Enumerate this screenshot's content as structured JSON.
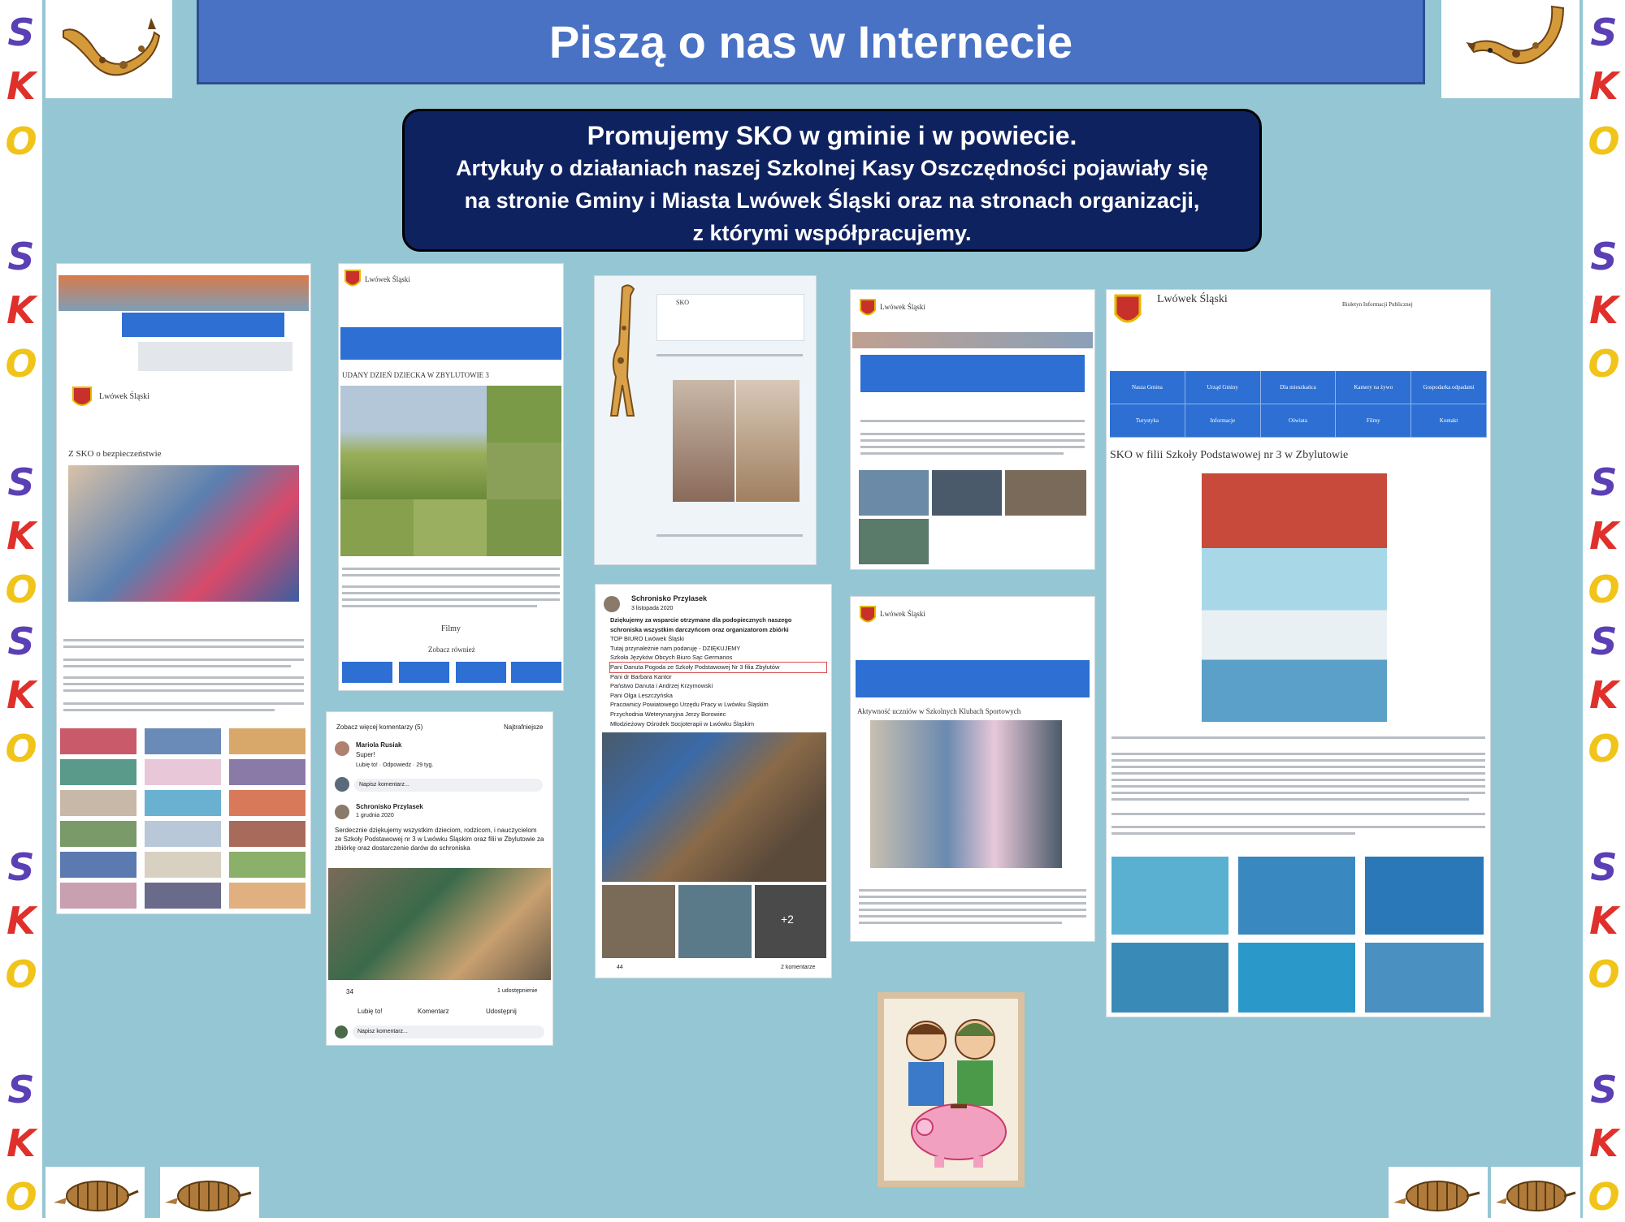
{
  "title": "Piszą o nas w Internecie",
  "intro": {
    "heading": "Promujemy  SKO w  gminie i w powiecie.",
    "line1": "Artykuły o działaniach naszej Szkolnej Kasy Oszczędności pojawiały się",
    "line2": "na stronie Gminy i Miasta Lwówek Śląski oraz  na stronach  organizacji,",
    "line3": "z którymi współpracujemy."
  },
  "side_letters": [
    "S",
    "K",
    "O",
    "S",
    "K",
    "O",
    "S",
    "K",
    "O",
    "S",
    "K",
    "O",
    "S",
    "K",
    "O",
    "S",
    "K",
    "O"
  ],
  "colors": {
    "panel": "#95c6d4",
    "banner": "#4a72c4",
    "textbox": "#0f2260",
    "nav": "#2d6fd3"
  },
  "icons": [
    "giraffe-icon",
    "armadillo-icon"
  ],
  "shots": {
    "s1": {
      "brand": "Lwówek Śląski",
      "heading": "Z SKO o bezpieczeństwie"
    },
    "s2": {
      "brand": "Lwówek Śląski",
      "heading": "UDANY DZIEŃ DZIECKA W ZBYLUTOWIE 3",
      "filmy": "Filmy",
      "more": "Zobacz również"
    },
    "s3": {
      "brand": "SKO"
    },
    "s4": {
      "brand": "Lwówek Śląski"
    },
    "s5": {
      "brand": "Lwówek Śląski",
      "bip": "Biuletyn Informacji Publicznej",
      "nav": [
        "Nasza Gmina",
        "Urząd Gminy",
        "Dla mieszkańca",
        "Kamery na żywo",
        "Gospodarka odpadami",
        "Turystyka",
        "Informacje",
        "Oświata",
        "Filmy",
        "Kontakt"
      ],
      "heading": "SKO w filii Szkoły Podstawowej nr 3 w Zbylutowie"
    },
    "s6": {
      "more_comments": "Zobacz więcej komentarzy (5)",
      "sort": "Najtrafniejsze",
      "commenter": "Mariola Rusiak",
      "comment": "Super!",
      "reply_meta": "Lubię to! · Odpowiedz · 29 tyg.",
      "write": "Napisz komentarz...",
      "page": "Schronisko Przylasek",
      "date": "1 grudnia 2020",
      "post": "Serdecznie dziękujemy wszystkim dzieciom, rodzicom, i nauczycielom ze Szkoły Podstawowej nr 3 w Lwówku Śląskim oraz filii w Zbylutowie za zbiórkę oraz dostarczenie darów do schroniska",
      "likes": "34",
      "shares": "1 udostępnienie",
      "like": "Lubię to!",
      "commentbtn": "Komentarz",
      "share": "Udostępnij"
    },
    "s7": {
      "page": "Schronisko Przylasek",
      "date": "3 listopada 2020",
      "post": [
        "Dziękujemy za wsparcie otrzymane dla podopiecznych naszego",
        "schroniska wszystkim darczyńcom oraz organizatorom zbiórki",
        "TOP BIURO Lwówek Śląski",
        "Tutaj przynależnie nam podaruję - DZIĘKUJEMY",
        "Szkoła Języków Obcych Biuro Sąc Germanos",
        "Pani Danuta Pogoda ze Szkoły Podstawowej Nr 3 filia Zbylutów",
        "Pani dr Barbara Kantor",
        "Państwo Danuta i Andrzej Krzymowski",
        "Pani Olga Leszczyńska",
        "Pracownicy Powiatowego Urzędu Pracy w Lwówku Śląskim",
        "Przychodnia Weterynaryjna Jerzy Borowiec",
        "Młodzieżowy Ośrodek Socjoterapii w Lwówku Śląskim"
      ],
      "plus": "+2",
      "likes": "44",
      "comments": "2 komentarze"
    },
    "s8": {
      "brand": "Lwówek Śląski",
      "heading": "Aktywność uczniów w Szkolnych Klubach Sportowych"
    }
  }
}
